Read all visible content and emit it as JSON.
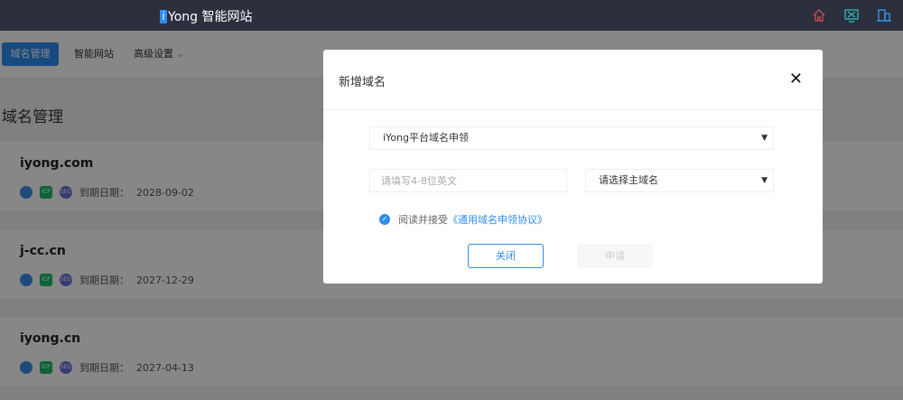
{
  "header": {
    "brand_i": "i",
    "brand_rest": "Yong 智能网站",
    "icons": [
      "home-icon",
      "monitor-icon",
      "building-icon"
    ]
  },
  "nav": {
    "tabs": [
      {
        "label": "域名管理"
      },
      {
        "label": "智能网站"
      },
      {
        "label": "高级设置"
      }
    ]
  },
  "page_title": "域名管理",
  "domains": [
    {
      "name": "iyong.com",
      "expiry_label": "到期日期：",
      "expiry": "2028-09-02"
    },
    {
      "name": "j-cc.cn",
      "expiry_label": "到期日期：",
      "expiry": "2027-12-29"
    },
    {
      "name": "iyong.cn",
      "expiry_label": "到期日期：",
      "expiry": "2027-04-13"
    }
  ],
  "badges": {
    "icp": "ICP",
    "seo": "SEO"
  },
  "modal": {
    "title": "新增域名",
    "type_select": "iYong平台域名申领",
    "name_placeholder": "请填写4-8位英文",
    "main_domain_select": "请选择主域名",
    "agree_text": "阅读并接受",
    "agreement_link": "《通用域名申领协议》",
    "close_label": "关闭",
    "apply_label": "申请"
  },
  "colors": {
    "accent": "#2d8cf0",
    "header": "#2c2f3c"
  }
}
